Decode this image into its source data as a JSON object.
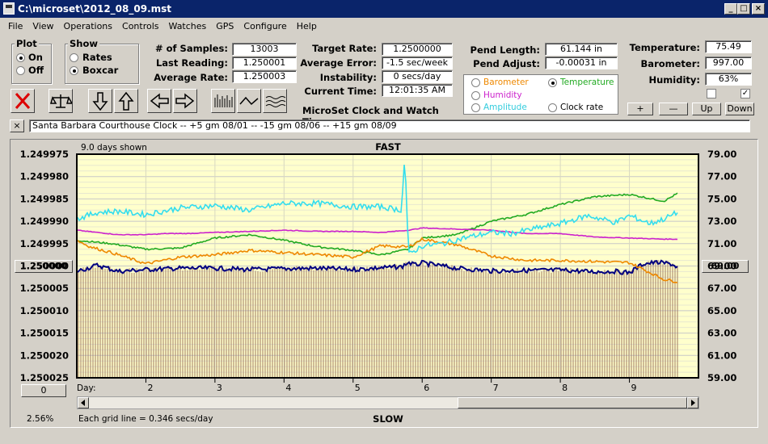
{
  "window": {
    "title": "C:\\microset\\2012_08_09.mst",
    "min": "_",
    "max": "□",
    "close": "×"
  },
  "menu": [
    "File",
    "View",
    "Operations",
    "Controls",
    "Watches",
    "GPS",
    "Configure",
    "Help"
  ],
  "plot_group": {
    "title": "Plot",
    "on": "On",
    "off": "Off"
  },
  "show_group": {
    "title": "Show",
    "rates": "Rates",
    "boxcar": "Boxcar"
  },
  "stats": {
    "samples_label": "# of Samples:",
    "samples": "13003",
    "last_label": "Last Reading:",
    "last": "1.250001",
    "avgrate_label": "Average Rate:",
    "avgrate": "1.250003",
    "target_label": "Target Rate:",
    "target": "1.2500000",
    "avgerr_label": "Average Error:",
    "avgerr": "-1.5 sec/week",
    "instab_label": "Instability:",
    "instab": "0 secs/day",
    "time_label": "Current Time:",
    "time": "12:01:35 AM",
    "pendlen_label": "Pend Length:",
    "pendlen": "61.144 in",
    "pendadj_label": "Pend Adjust:",
    "pendadj": "-0.00031 in",
    "temp_label": "Temperature:",
    "temp": "75.49",
    "baro_label": "Barometer:",
    "baro": "997.00",
    "hum_label": "Humidity:",
    "hum": "63%"
  },
  "app_title": "MicroSet Clock and Watch Timer",
  "overlay": {
    "barometer": "Barometer",
    "temperature": "Temperature",
    "humidity": "Humidity",
    "amplitude": "Amplitude",
    "clockrate": "Clock rate"
  },
  "overlay_buttons": {
    "plus": "+",
    "minus": "—",
    "up": "Up",
    "down": "Down"
  },
  "description": "Santa Barbara Courthouse Clock  --  +5 gm 08/01 --  -15 gm 08/06  --  +15 gm 08/09",
  "desc_close": "×",
  "chart_labels": {
    "days_shown": "9.0 days shown",
    "fast": "FAST",
    "slow": "SLOW",
    "day": "Day:",
    "grid_note": "Each grid line = 0.346 secs/day",
    "zoom": "2.56%",
    "center_left": "1.250000",
    "center_right": "69.00",
    "left_bottom": "0"
  },
  "colors": {
    "bars": "#a07860",
    "rate": "#000080",
    "cyan": "#33ddee",
    "magenta": "#cc22cc",
    "green": "#22aa22",
    "orange": "#ee8800",
    "bg": "#ffffcc"
  },
  "chart_data": {
    "type": "line",
    "left_axis": [
      "1.249975",
      "1.249980",
      "1.249985",
      "1.249990",
      "1.249995",
      "1.250000",
      "1.250005",
      "1.250010",
      "1.250015",
      "1.250020",
      "1.250025"
    ],
    "right_axis": [
      "79.00",
      "77.00",
      "75.00",
      "73.00",
      "71.00",
      "69.00",
      "67.00",
      "65.00",
      "63.00",
      "61.00",
      "59.00"
    ],
    "x_ticks": [
      "2",
      "3",
      "4",
      "5",
      "6",
      "7",
      "8",
      "9"
    ],
    "ylim_left": [
      1.249975,
      1.250025
    ],
    "ylim_right": [
      59,
      79
    ],
    "xlim": [
      1,
      10
    ],
    "series": [
      {
        "name": "Clock rate",
        "x": [
          1,
          1.3,
          1.6,
          2,
          2.5,
          3,
          3.5,
          4,
          4.5,
          5,
          5.4,
          5.7,
          5.8,
          5.9,
          6.0,
          6.2,
          6.5,
          7,
          7.5,
          8,
          8.5,
          8.8,
          9,
          9.2,
          9.4,
          9.6,
          9.7
        ],
        "y": [
          1.2500012,
          1.2499998,
          1.2500012,
          1.2500008,
          1.2500005,
          1.2500005,
          1.2500008,
          1.2500006,
          1.2500005,
          1.2500008,
          1.2500004,
          1.2500002,
          1.2499992,
          1.2499998,
          1.2499993,
          1.2499998,
          1.2500005,
          1.2500011,
          1.250001,
          1.2500009,
          1.2500013,
          1.2500012,
          1.2500015,
          1.2499995,
          1.2499992,
          1.2499995,
          1.2500003
        ]
      },
      {
        "name": "Temperature",
        "x": [
          1,
          1.5,
          2,
          2.5,
          3,
          3.5,
          4,
          4.5,
          5,
          5.4,
          5.8,
          6,
          6.5,
          7,
          7.5,
          8,
          8.5,
          9,
          9.5,
          9.7
        ],
        "y": [
          71.3,
          71.0,
          70.5,
          70.6,
          71.5,
          71.8,
          71.3,
          70.7,
          70.4,
          70.0,
          70.5,
          71.5,
          71.8,
          73.0,
          73.6,
          74.5,
          75.2,
          75.4,
          74.8,
          75.5
        ]
      },
      {
        "name": "Humidity",
        "x": [
          1,
          1.3,
          1.6,
          2,
          2.3,
          2.6,
          3,
          3.5,
          4,
          4.5,
          5,
          5.4,
          5.8,
          6,
          6.5,
          7,
          7.5,
          8,
          8.5,
          9,
          9.5,
          9.7
        ],
        "y": [
          72.2,
          72.0,
          71.8,
          71.8,
          71.9,
          71.9,
          72.0,
          72.1,
          72.2,
          72.1,
          72.1,
          72.0,
          72.2,
          72.4,
          72.3,
          72.2,
          71.9,
          71.9,
          71.6,
          71.5,
          71.4,
          71.4
        ]
      },
      {
        "name": "Barometer",
        "x": [
          1,
          1.2,
          1.5,
          2,
          2.5,
          3,
          3.5,
          4,
          4.5,
          5,
          5.4,
          5.8,
          6,
          6.5,
          7,
          7.5,
          8,
          8.5,
          9,
          9.3,
          9.5,
          9.7
        ],
        "y": [
          71.3,
          70.7,
          70.2,
          69.2,
          69.8,
          70.0,
          70.4,
          70.2,
          70.0,
          69.8,
          70.8,
          70.7,
          71.4,
          70.9,
          69.9,
          69.5,
          69.5,
          69.4,
          69.3,
          68.4,
          67.8,
          67.6
        ]
      },
      {
        "name": "Amplitude",
        "x": [
          1,
          1.3,
          1.6,
          2,
          2.5,
          3,
          3.5,
          4,
          4.5,
          5,
          5.4,
          5.7,
          5.75,
          5.8,
          6,
          6.3,
          6.6,
          7,
          7.3,
          7.6,
          8,
          8.4,
          8.8,
          9,
          9.3,
          9.5,
          9.7
        ],
        "y": [
          73.2,
          73.8,
          73.9,
          73.6,
          74.2,
          74.4,
          74.0,
          74.6,
          74.6,
          74.3,
          74.3,
          74.0,
          79.0,
          70.0,
          70.8,
          71.0,
          71.5,
          72.0,
          71.9,
          72.3,
          72.8,
          73.5,
          72.9,
          73.5,
          72.8,
          73.2,
          73.8
        ]
      }
    ]
  }
}
